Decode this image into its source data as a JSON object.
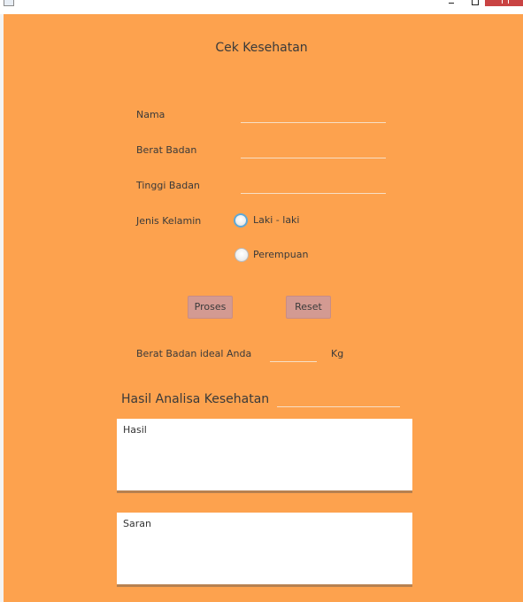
{
  "window": {
    "title_icon": "app-window-icon",
    "controls": [
      "minimize-icon",
      "maximize-icon",
      "close-icon"
    ],
    "close_color": "#c94343"
  },
  "form": {
    "background": "#fda24e",
    "title": "Cek Kesehatan",
    "nama_label": "Nama",
    "nama_value": "",
    "berat_label": "Berat Badan",
    "berat_value": "",
    "tinggi_label": "Tinggi Badan",
    "tinggi_value": "",
    "kelamin_label": "Jenis Kelamin",
    "kelamin_options": [
      "Laki - laki",
      "Perempuan"
    ],
    "kelamin_selected": ""
  },
  "buttons": {
    "proses": "Proses",
    "reset": "Reset",
    "color": "#d39a92"
  },
  "ideal": {
    "label": "Berat Badan ideal Anda",
    "value": "",
    "unit": "Kg"
  },
  "analysis": {
    "heading": "Hasil Analisa Kesehatan",
    "value": "",
    "hasil_text": "Hasil",
    "saran_text": "Saran"
  }
}
